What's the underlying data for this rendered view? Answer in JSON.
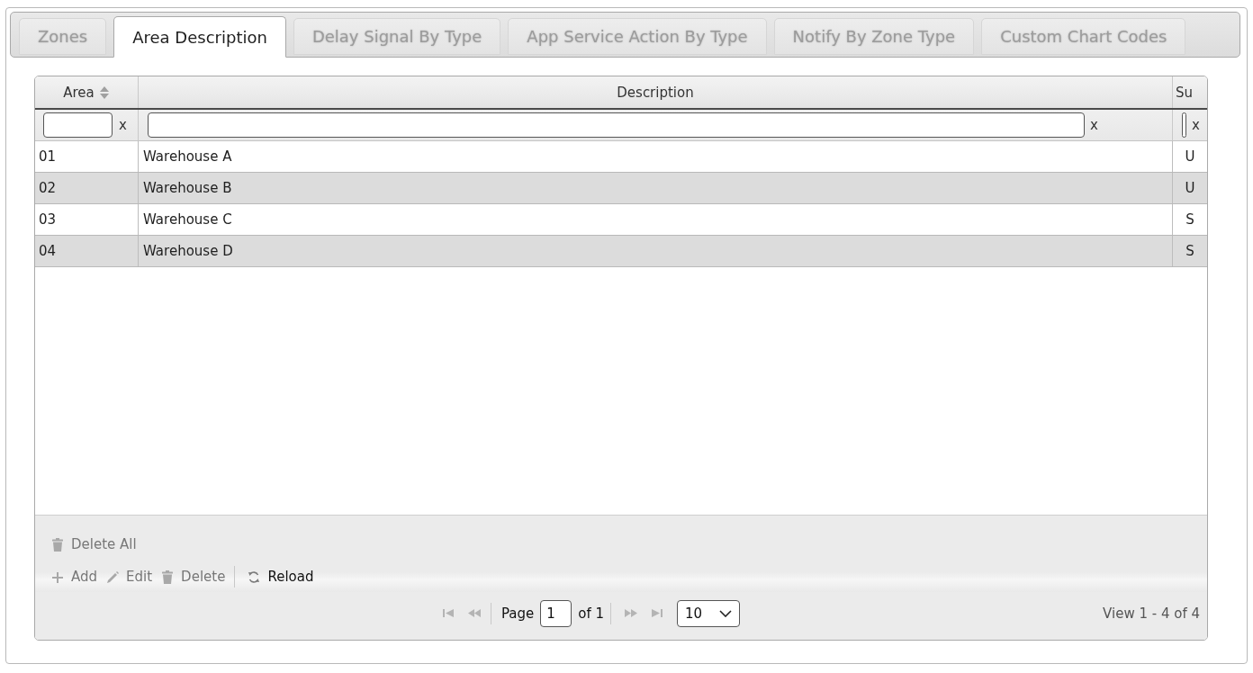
{
  "tabs": [
    {
      "label": "Zones",
      "selected": false
    },
    {
      "label": "Area Description",
      "selected": true
    },
    {
      "label": "Delay Signal By Type",
      "selected": false
    },
    {
      "label": "App Service Action By Type",
      "selected": false
    },
    {
      "label": "Notify By Zone Type",
      "selected": false
    },
    {
      "label": "Custom Chart Codes",
      "selected": false
    }
  ],
  "grid": {
    "columns": [
      {
        "label": "Area",
        "sortable": true,
        "clear_label": "x"
      },
      {
        "label": "Description",
        "sortable": false,
        "clear_label": "x"
      },
      {
        "label": "Su",
        "sortable": false,
        "clear_label": "x"
      }
    ],
    "rows": [
      {
        "cells": [
          "01",
          "Warehouse A",
          "U"
        ]
      },
      {
        "cells": [
          "02",
          "Warehouse B",
          "U"
        ]
      },
      {
        "cells": [
          "03",
          "Warehouse C",
          "S"
        ]
      },
      {
        "cells": [
          "04",
          "Warehouse D",
          "S"
        ]
      }
    ]
  },
  "toolbar": {
    "rows": [
      {
        "buttons": [
          {
            "kind": "trash",
            "label": "Delete All",
            "disabled": true,
            "separated": false
          }
        ]
      },
      {
        "buttons": [
          {
            "kind": "plus",
            "label": "Add",
            "disabled": true,
            "separated": false
          },
          {
            "kind": "pencil",
            "label": "Edit",
            "disabled": true,
            "separated": false
          },
          {
            "kind": "trash",
            "label": "Delete",
            "disabled": true,
            "separated": false
          },
          {
            "kind": "reload",
            "label": "Reload",
            "disabled": false,
            "separated": true
          }
        ]
      }
    ]
  },
  "pager": {
    "nav_before": [
      {
        "kind": "first",
        "disabled": true
      },
      {
        "kind": "prev",
        "disabled": true
      }
    ],
    "page_label": "Page",
    "page": "1",
    "total_label": "of 1",
    "nav_after": [
      {
        "kind": "next",
        "disabled": true
      },
      {
        "kind": "last",
        "disabled": true
      }
    ],
    "page_size": "10",
    "record_info": "View 1 - 4 of 4"
  }
}
